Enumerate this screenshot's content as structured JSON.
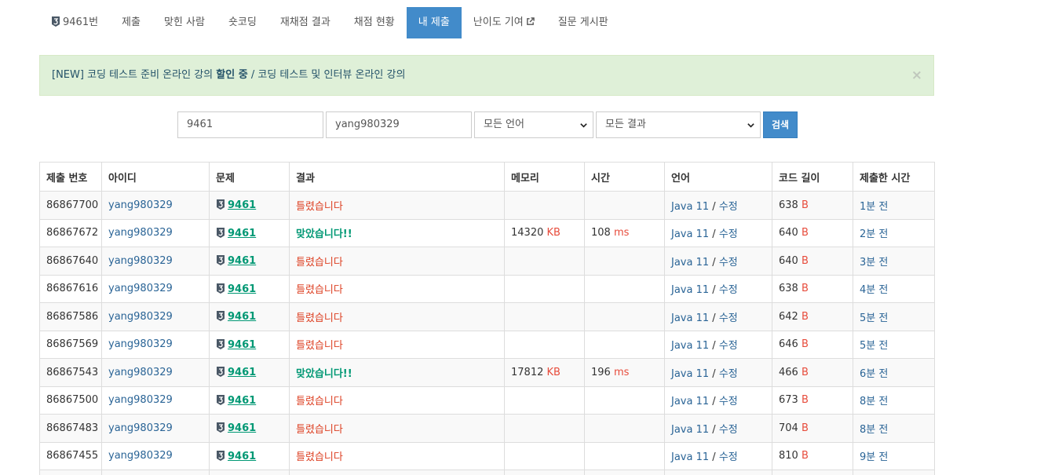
{
  "nav": {
    "items": [
      {
        "name": "nav-problem",
        "label": "9461번",
        "tier": "3",
        "active": false
      },
      {
        "name": "nav-submit",
        "label": "제출",
        "active": false
      },
      {
        "name": "nav-solved-users",
        "label": "맞힌 사람",
        "active": false
      },
      {
        "name": "nav-short-coding",
        "label": "숏코딩",
        "active": false
      },
      {
        "name": "nav-rejudge-result",
        "label": "재채점 결과",
        "active": false
      },
      {
        "name": "nav-judge-status",
        "label": "채점 현황",
        "active": false
      },
      {
        "name": "nav-my-submissions",
        "label": "내 제출",
        "active": true
      },
      {
        "name": "nav-difficulty",
        "label": "난이도 기여",
        "active": false,
        "external": true
      },
      {
        "name": "nav-board",
        "label": "질문 게시판",
        "active": false
      }
    ]
  },
  "alert": {
    "prefix": "[NEW] 코딩 테스트 준비 온라인 강의",
    "highlight": "할인 중",
    "separator": "/",
    "suffix": "코딩 테스트 및 인터뷰 온라인 강의",
    "close": "×"
  },
  "search": {
    "problem_id": "9461",
    "user_id": "yang980329",
    "language": "모든 언어",
    "result": "모든 결과",
    "button": "검색"
  },
  "table": {
    "headers": [
      "제출 번호",
      "아이디",
      "문제",
      "결과",
      "메모리",
      "시간",
      "언어",
      "코드 길이",
      "제출한 시간"
    ],
    "rows": [
      {
        "id": "86867700",
        "user": "yang980329",
        "tier": "3",
        "problem": "9461",
        "result": "틀렸습니다",
        "status": "wrong",
        "memory": "",
        "memory_unit": "",
        "time": "",
        "time_unit": "",
        "lang": "Java 11",
        "edit": "수정",
        "length": "638",
        "length_unit": "B",
        "submitted": "1분 전"
      },
      {
        "id": "86867672",
        "user": "yang980329",
        "tier": "3",
        "problem": "9461",
        "result": "맞았습니다!!",
        "status": "ac",
        "memory": "14320",
        "memory_unit": "KB",
        "time": "108",
        "time_unit": "ms",
        "lang": "Java 11",
        "edit": "수정",
        "length": "640",
        "length_unit": "B",
        "submitted": "2분 전"
      },
      {
        "id": "86867640",
        "user": "yang980329",
        "tier": "3",
        "problem": "9461",
        "result": "틀렸습니다",
        "status": "wrong",
        "memory": "",
        "memory_unit": "",
        "time": "",
        "time_unit": "",
        "lang": "Java 11",
        "edit": "수정",
        "length": "640",
        "length_unit": "B",
        "submitted": "3분 전"
      },
      {
        "id": "86867616",
        "user": "yang980329",
        "tier": "3",
        "problem": "9461",
        "result": "틀렸습니다",
        "status": "wrong",
        "memory": "",
        "memory_unit": "",
        "time": "",
        "time_unit": "",
        "lang": "Java 11",
        "edit": "수정",
        "length": "638",
        "length_unit": "B",
        "submitted": "4분 전"
      },
      {
        "id": "86867586",
        "user": "yang980329",
        "tier": "3",
        "problem": "9461",
        "result": "틀렸습니다",
        "status": "wrong",
        "memory": "",
        "memory_unit": "",
        "time": "",
        "time_unit": "",
        "lang": "Java 11",
        "edit": "수정",
        "length": "642",
        "length_unit": "B",
        "submitted": "5분 전"
      },
      {
        "id": "86867569",
        "user": "yang980329",
        "tier": "3",
        "problem": "9461",
        "result": "틀렸습니다",
        "status": "wrong",
        "memory": "",
        "memory_unit": "",
        "time": "",
        "time_unit": "",
        "lang": "Java 11",
        "edit": "수정",
        "length": "646",
        "length_unit": "B",
        "submitted": "5분 전"
      },
      {
        "id": "86867543",
        "user": "yang980329",
        "tier": "3",
        "problem": "9461",
        "result": "맞았습니다!!",
        "status": "ac",
        "memory": "17812",
        "memory_unit": "KB",
        "time": "196",
        "time_unit": "ms",
        "lang": "Java 11",
        "edit": "수정",
        "length": "466",
        "length_unit": "B",
        "submitted": "6분 전"
      },
      {
        "id": "86867500",
        "user": "yang980329",
        "tier": "3",
        "problem": "9461",
        "result": "틀렸습니다",
        "status": "wrong",
        "memory": "",
        "memory_unit": "",
        "time": "",
        "time_unit": "",
        "lang": "Java 11",
        "edit": "수정",
        "length": "673",
        "length_unit": "B",
        "submitted": "8분 전"
      },
      {
        "id": "86867483",
        "user": "yang980329",
        "tier": "3",
        "problem": "9461",
        "result": "틀렸습니다",
        "status": "wrong",
        "memory": "",
        "memory_unit": "",
        "time": "",
        "time_unit": "",
        "lang": "Java 11",
        "edit": "수정",
        "length": "704",
        "length_unit": "B",
        "submitted": "8분 전"
      },
      {
        "id": "86867455",
        "user": "yang980329",
        "tier": "3",
        "problem": "9461",
        "result": "틀렸습니다",
        "status": "wrong",
        "memory": "",
        "memory_unit": "",
        "time": "",
        "time_unit": "",
        "lang": "Java 11",
        "edit": "수정",
        "length": "810",
        "length_unit": "B",
        "submitted": "9분 전"
      },
      {
        "id": "",
        "user": "",
        "tier": "",
        "problem": "",
        "result": "",
        "status": "wrong",
        "memory": "",
        "memory_unit": "",
        "time": "",
        "time_unit": "",
        "lang": "",
        "edit": "",
        "length": "",
        "length_unit": "",
        "submitted": ""
      }
    ]
  },
  "colors": {
    "primary": "#428bca",
    "link": "#2a6496",
    "accepted": "#009874",
    "wrong": "#dd4124",
    "unit": "#e74c3c",
    "tier_badge": "#4a5866"
  },
  "icons": {
    "tier": "silver-tier-icon",
    "external": "external-link-icon",
    "close": "close-icon",
    "select": "chevron-down-icon"
  }
}
